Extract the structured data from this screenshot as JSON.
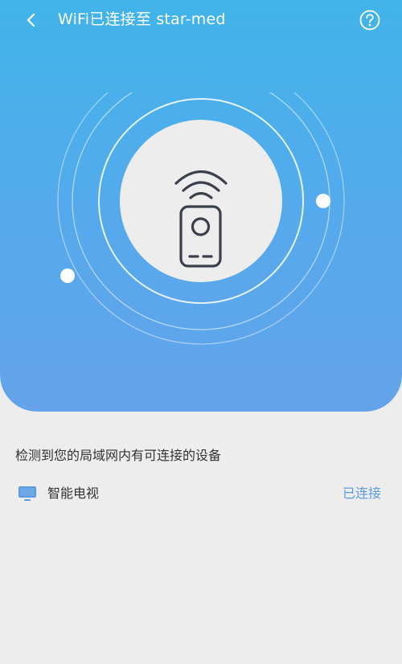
{
  "header": {
    "title": "WiFi已连接至 star-med",
    "back_icon": "chevron-left-icon",
    "help_icon": "question-circle-icon"
  },
  "hero": {
    "icon": "remote-control-wifi-icon",
    "gradient_top": "#41b4e9",
    "gradient_bottom": "#64a3ea"
  },
  "devices_section": {
    "title": "检测到您的局域网内有可连接的设备",
    "items": [
      {
        "icon": "tv-icon",
        "name": "智能电视",
        "status": "已连接",
        "subtitle": "· ·  ·- ·  ·"
      }
    ]
  },
  "colors": {
    "accent": "#5a9be0",
    "background": "#ededed",
    "text": "#333333"
  }
}
